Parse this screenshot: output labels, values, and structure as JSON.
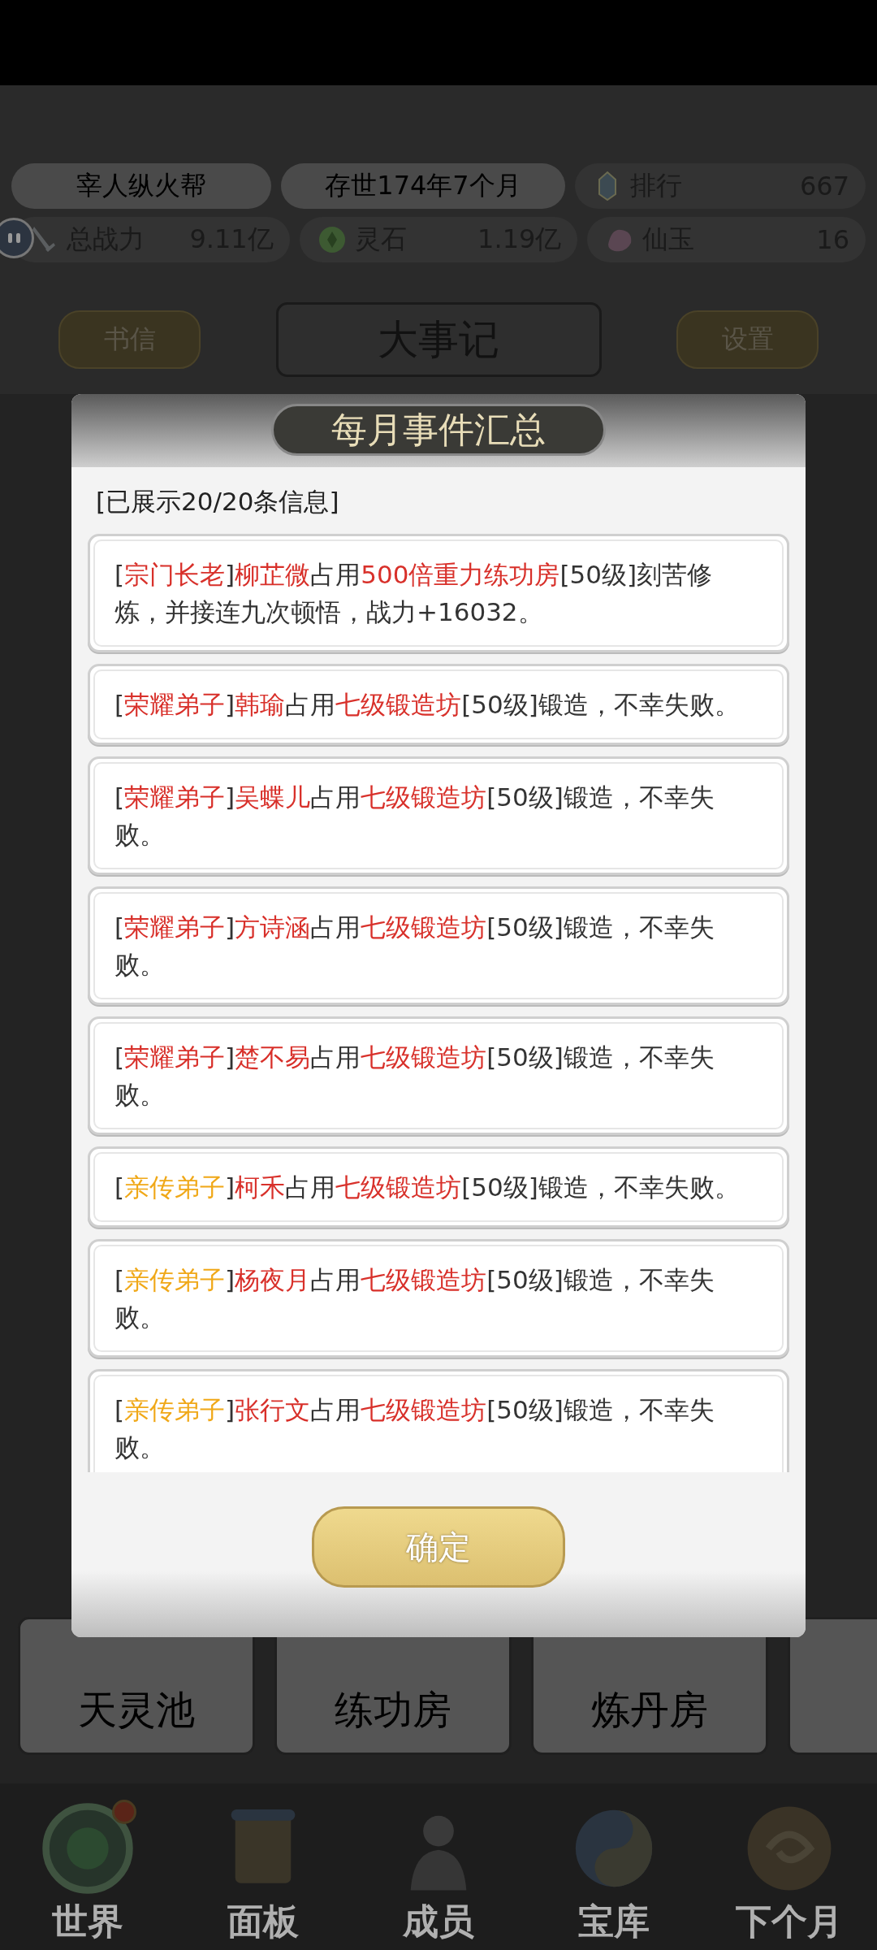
{
  "header": {
    "sect_name": "宰人纵火帮",
    "age": "存世174年7个月",
    "stats": [
      {
        "kind": "rank",
        "label": "排行",
        "value": "667"
      },
      {
        "kind": "power",
        "label": "总战力",
        "value": "9.11亿"
      },
      {
        "kind": "stone",
        "label": "灵石",
        "value": "1.19亿"
      },
      {
        "kind": "jade",
        "label": "仙玉",
        "value": "16"
      }
    ]
  },
  "nav_buttons": {
    "left": "书信",
    "title": "大事记",
    "right": "设置"
  },
  "dialog": {
    "title": "每月事件汇总",
    "info": "[已展示20/20条信息]",
    "events": [
      {
        "segments": [
          {
            "text": "[",
            "kind": "plain"
          },
          {
            "text": "宗门长老",
            "kind": "elder"
          },
          {
            "text": "]",
            "kind": "plain"
          },
          {
            "text": "柳芷微",
            "kind": "key"
          },
          {
            "text": "占用",
            "kind": "plain"
          },
          {
            "text": "500倍重力练功房",
            "kind": "key"
          },
          {
            "text": "[50级]刻苦修炼，并接连九次顿悟，战力+16032。",
            "kind": "plain"
          }
        ]
      },
      {
        "segments": [
          {
            "text": "[",
            "kind": "plain"
          },
          {
            "text": "荣耀弟子",
            "kind": "honor"
          },
          {
            "text": "]",
            "kind": "plain"
          },
          {
            "text": "韩瑜",
            "kind": "key"
          },
          {
            "text": "占用",
            "kind": "plain"
          },
          {
            "text": "七级锻造坊",
            "kind": "key"
          },
          {
            "text": "[50级]锻造，不幸失败。",
            "kind": "plain"
          }
        ]
      },
      {
        "segments": [
          {
            "text": "[",
            "kind": "plain"
          },
          {
            "text": "荣耀弟子",
            "kind": "honor"
          },
          {
            "text": "]",
            "kind": "plain"
          },
          {
            "text": "吴蝶儿",
            "kind": "key"
          },
          {
            "text": "占用",
            "kind": "plain"
          },
          {
            "text": "七级锻造坊",
            "kind": "key"
          },
          {
            "text": "[50级]锻造，不幸失败。",
            "kind": "plain"
          }
        ]
      },
      {
        "segments": [
          {
            "text": "[",
            "kind": "plain"
          },
          {
            "text": "荣耀弟子",
            "kind": "honor"
          },
          {
            "text": "]",
            "kind": "plain"
          },
          {
            "text": "方诗涵",
            "kind": "key"
          },
          {
            "text": "占用",
            "kind": "plain"
          },
          {
            "text": "七级锻造坊",
            "kind": "key"
          },
          {
            "text": "[50级]锻造，不幸失败。",
            "kind": "plain"
          }
        ]
      },
      {
        "segments": [
          {
            "text": "[",
            "kind": "plain"
          },
          {
            "text": "荣耀弟子",
            "kind": "honor"
          },
          {
            "text": "]",
            "kind": "plain"
          },
          {
            "text": "楚不易",
            "kind": "key"
          },
          {
            "text": "占用",
            "kind": "plain"
          },
          {
            "text": "七级锻造坊",
            "kind": "key"
          },
          {
            "text": "[50级]锻造，不幸失败。",
            "kind": "plain"
          }
        ]
      },
      {
        "segments": [
          {
            "text": "[",
            "kind": "plain"
          },
          {
            "text": "亲传弟子",
            "kind": "personal"
          },
          {
            "text": "]",
            "kind": "plain"
          },
          {
            "text": "柯禾",
            "kind": "key"
          },
          {
            "text": "占用",
            "kind": "plain"
          },
          {
            "text": "七级锻造坊",
            "kind": "key"
          },
          {
            "text": "[50级]锻造，不幸失败。",
            "kind": "plain"
          }
        ]
      },
      {
        "segments": [
          {
            "text": "[",
            "kind": "plain"
          },
          {
            "text": "亲传弟子",
            "kind": "personal"
          },
          {
            "text": "]",
            "kind": "plain"
          },
          {
            "text": "杨夜月",
            "kind": "key"
          },
          {
            "text": "占用",
            "kind": "plain"
          },
          {
            "text": "七级锻造坊",
            "kind": "key"
          },
          {
            "text": "[50级]锻造，不幸失败。",
            "kind": "plain"
          }
        ]
      },
      {
        "segments": [
          {
            "text": "[",
            "kind": "plain"
          },
          {
            "text": "亲传弟子",
            "kind": "personal"
          },
          {
            "text": "]",
            "kind": "plain"
          },
          {
            "text": "张行文",
            "kind": "key"
          },
          {
            "text": "占用",
            "kind": "plain"
          },
          {
            "text": "七级锻造坊",
            "kind": "key"
          },
          {
            "text": "[50级]锻造，不幸失败。",
            "kind": "plain"
          }
        ]
      }
    ],
    "confirm": "确定"
  },
  "buildings": [
    "天灵池",
    "练功房",
    "炼丹房"
  ],
  "bottom_nav": [
    {
      "kind": "world",
      "label": "世界",
      "badge": true
    },
    {
      "kind": "panel",
      "label": "面板",
      "badge": false
    },
    {
      "kind": "members",
      "label": "成员",
      "badge": false
    },
    {
      "kind": "treasury",
      "label": "宝库",
      "badge": false
    },
    {
      "kind": "next",
      "label": "下个月",
      "badge": false
    }
  ]
}
